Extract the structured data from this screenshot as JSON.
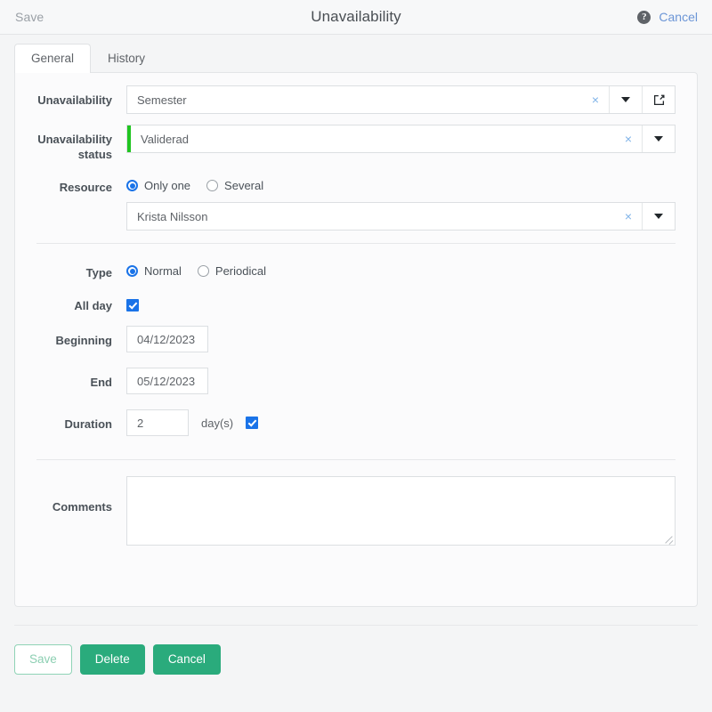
{
  "header": {
    "save_label": "Save",
    "title": "Unavailability",
    "help_icon": "help-circle-icon",
    "cancel_label": "Cancel"
  },
  "tabs": [
    {
      "label": "General",
      "active": true
    },
    {
      "label": "History",
      "active": false
    }
  ],
  "form": {
    "unavailability": {
      "label": "Unavailability",
      "value": "Semester",
      "clear_icon": "×",
      "caret_icon": "chevron-down-icon",
      "edit_icon": "pencil-square-icon"
    },
    "unavailability_status": {
      "label": "Unavailability status",
      "value": "Validerad",
      "status_color": "#21c521",
      "clear_icon": "×",
      "caret_icon": "chevron-down-icon"
    },
    "resource": {
      "label": "Resource",
      "options": [
        {
          "label": "Only one",
          "selected": true
        },
        {
          "label": "Several",
          "selected": false
        }
      ],
      "value": "Krista Nilsson",
      "clear_icon": "×",
      "caret_icon": "chevron-down-icon"
    },
    "type": {
      "label": "Type",
      "options": [
        {
          "label": "Normal",
          "selected": true
        },
        {
          "label": "Periodical",
          "selected": false
        }
      ]
    },
    "all_day": {
      "label": "All day",
      "checked": true
    },
    "beginning": {
      "label": "Beginning",
      "value": "04/12/2023"
    },
    "end": {
      "label": "End",
      "value": "05/12/2023"
    },
    "duration": {
      "label": "Duration",
      "value": "2",
      "unit": "day(s)",
      "checked": true
    },
    "comments": {
      "label": "Comments",
      "value": ""
    }
  },
  "footer": {
    "save_label": "Save",
    "delete_label": "Delete",
    "cancel_label": "Cancel",
    "accent_color": "#2aab7c"
  }
}
